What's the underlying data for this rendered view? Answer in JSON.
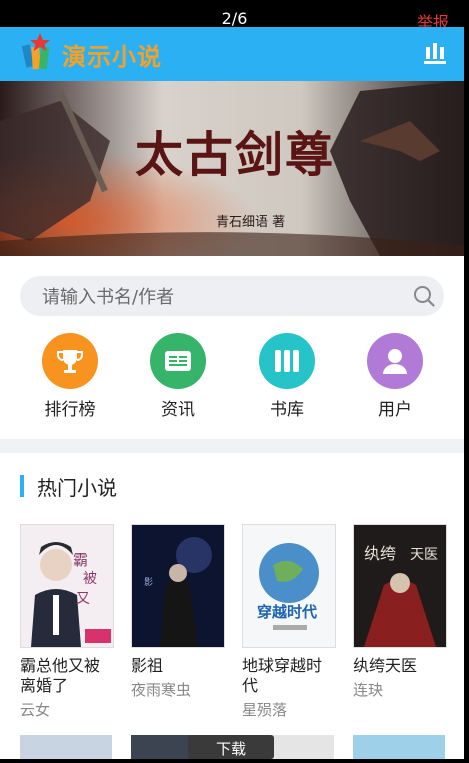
{
  "status_bar": {
    "counter": "2/6",
    "report": "举报"
  },
  "header": {
    "app_name": "演示小说",
    "menu_icon": "bar-chart-icon"
  },
  "banner": {
    "title_art": "太古剑尊",
    "subtitle": "青石细语 著",
    "dots_total": 4,
    "active_dot": 1
  },
  "search": {
    "placeholder": "请输入书名/作者",
    "icon": "search-icon"
  },
  "nav": [
    {
      "label": "排行榜",
      "icon": "trophy-icon",
      "color": "#f7931e"
    },
    {
      "label": "资讯",
      "icon": "news-icon",
      "color": "#36b56a"
    },
    {
      "label": "书库",
      "icon": "bookshelf-icon",
      "color": "#26c3c9"
    },
    {
      "label": "用户",
      "icon": "user-icon",
      "color": "#b07ad6"
    }
  ],
  "hot": {
    "title": "热门小说",
    "books": [
      {
        "title": "霸总他又被离婚了",
        "author": "云女"
      },
      {
        "title": "影祖",
        "author": "夜雨寒虫"
      },
      {
        "title": "地球穿越时代",
        "author": "星殒落"
      },
      {
        "title": "纨绔天医",
        "author": "连玦"
      }
    ]
  },
  "download": {
    "label": "下载"
  },
  "colors": {
    "accent": "#2bb0f3",
    "report": "#e53935",
    "logo_text": "#f3a128"
  }
}
